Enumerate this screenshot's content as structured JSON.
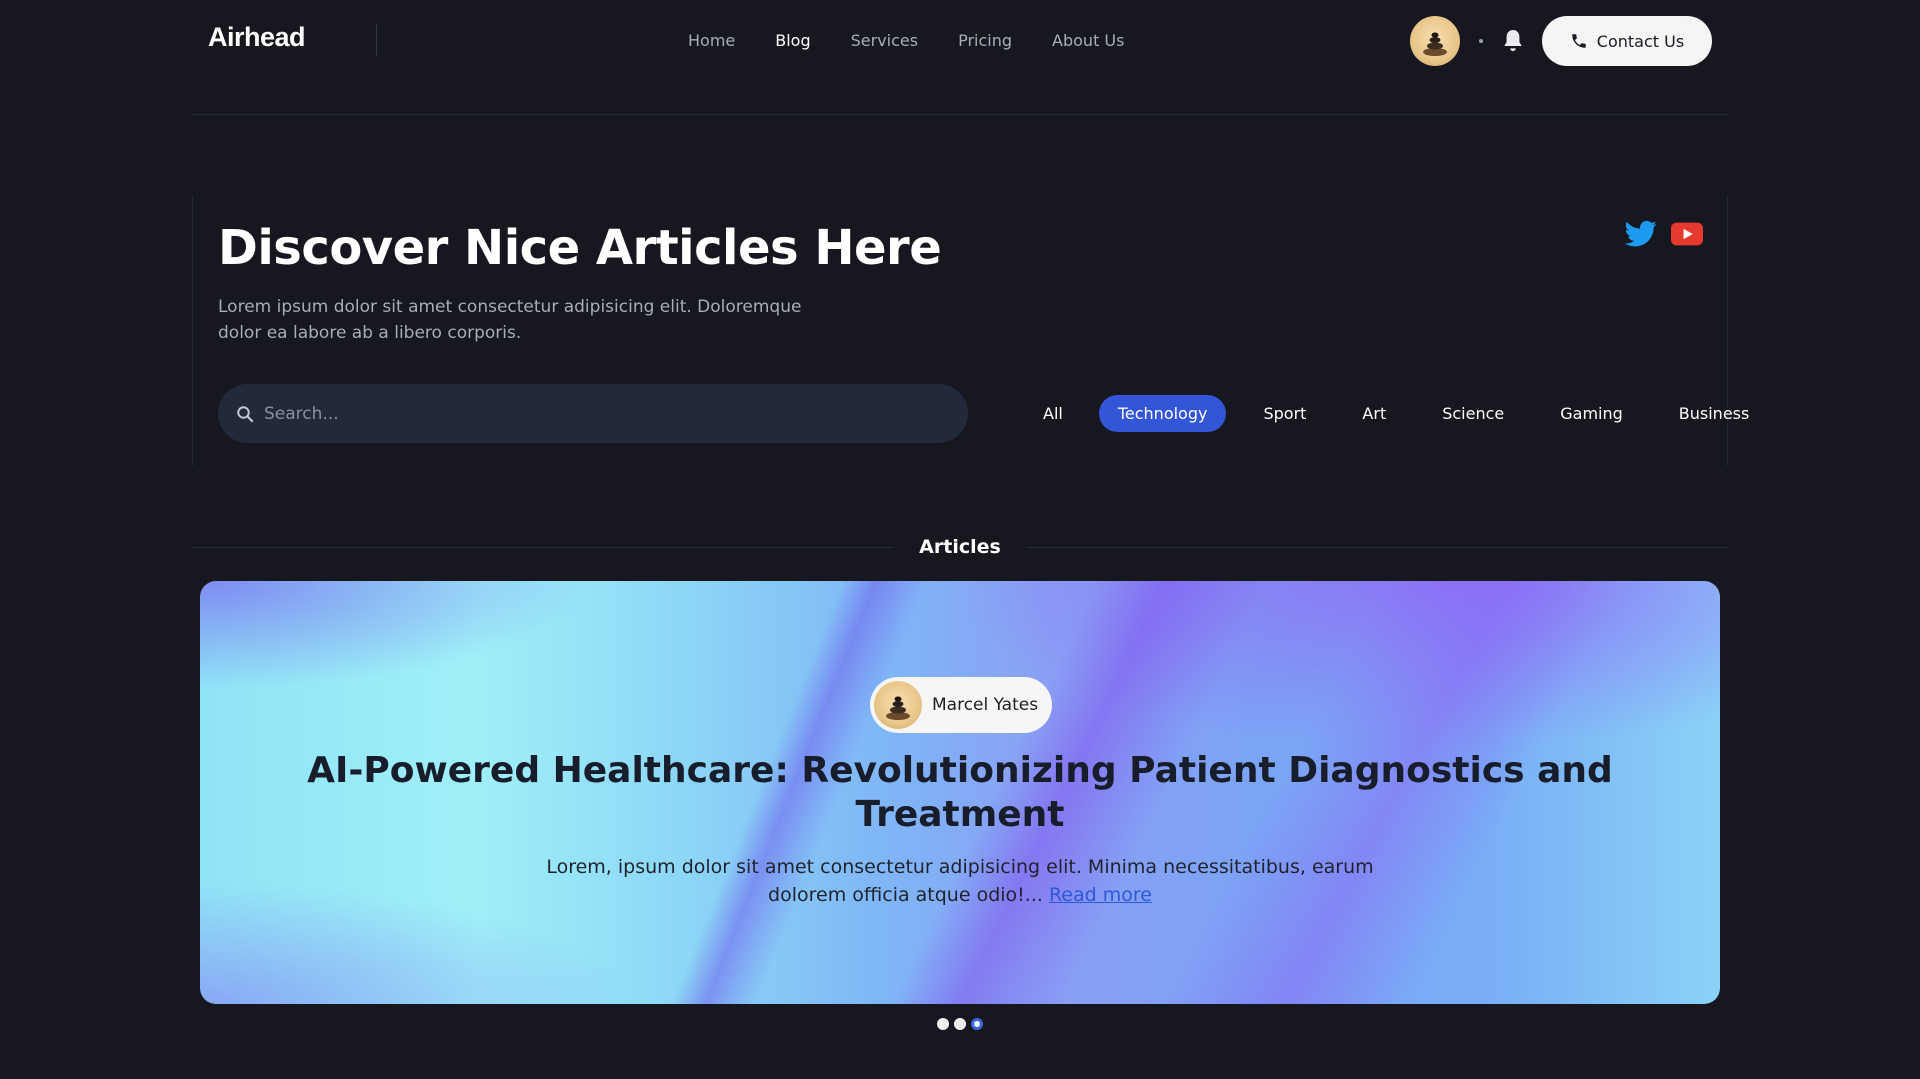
{
  "header": {
    "logo": "Airhead",
    "nav": [
      "Home",
      "Blog",
      "Services",
      "Pricing",
      "About Us"
    ],
    "active_nav": "Blog",
    "contact_label": "Contact Us",
    "icons": {
      "avatar": "user-avatar",
      "bell": "bell-icon",
      "phone": "phone-icon"
    }
  },
  "hero": {
    "title": "Discover Nice Articles Here",
    "subtitle": "Lorem ipsum dolor sit amet consectetur adipisicing elit. Doloremque dolor ea labore ab a libero corporis.",
    "search_placeholder": "Search...",
    "filters": [
      "All",
      "Technology",
      "Sport",
      "Art",
      "Science",
      "Gaming",
      "Business"
    ],
    "active_filter": "Technology",
    "socials": [
      {
        "name": "twitter-icon",
        "color": "#1d9bf0"
      },
      {
        "name": "youtube-icon",
        "color": "#e53a2d"
      }
    ]
  },
  "articles": {
    "heading": "Articles",
    "featured": {
      "author": "Marcel Yates",
      "title": "AI-Powered Healthcare: Revolutionizing Patient Diagnostics and Treatment",
      "excerpt": "Lorem, ipsum dolor sit amet consectetur adipisicing elit. Minima necessitatibus, earum dolorem officia atque odio!...",
      "read_more": "Read more"
    },
    "pager": {
      "count": 3,
      "active_index": 2
    }
  },
  "colors": {
    "accent": "#3355d8",
    "background": "#171720"
  }
}
